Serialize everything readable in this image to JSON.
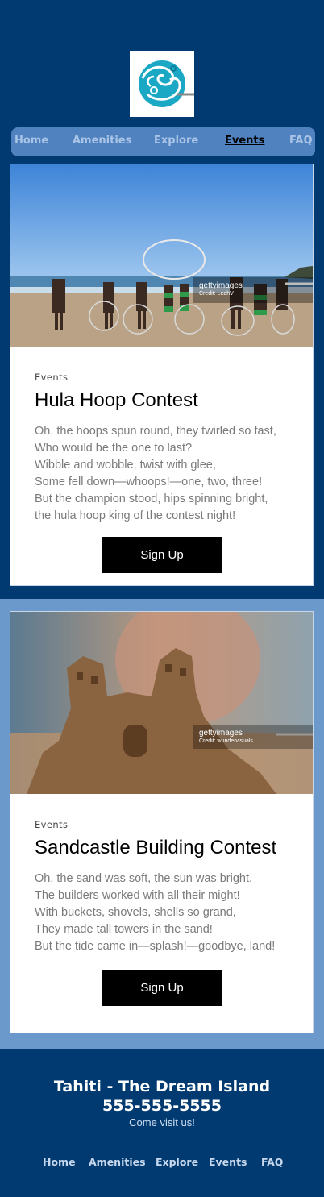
{
  "nav": {
    "items": [
      {
        "label": "Home",
        "active": false
      },
      {
        "label": "Amenities",
        "active": false
      },
      {
        "label": "Explore",
        "active": false
      },
      {
        "label": "Events",
        "active": true
      },
      {
        "label": "FAQ",
        "active": false
      }
    ]
  },
  "cards": [
    {
      "eyebrow": "Events",
      "title": "Hula Hoop Contest",
      "poem": "Oh, the hoops spun round, they twirled so fast,\nWho would be the one to last?\nWibble and wobble, twist with glee,\nSome fell down—whoops!—one, two, three!\nBut the champion stood, hips spinning bright,\nthe hula hoop king of the contest night!",
      "button": "Sign Up",
      "watermark": "gettyimages",
      "credit": "Credit: LeahV"
    },
    {
      "eyebrow": "Events",
      "title": "Sandcastle Building Contest",
      "poem": "Oh, the sand was soft, the sun was bright,\nThe builders worked with all their might!\nWith buckets, shovels, shells so grand,\nThey made tall towers in the sand!\nBut the tide came in—splash!—goodbye, land!",
      "button": "Sign Up",
      "watermark": "gettyimages",
      "credit": "Credit: wundervisuals"
    }
  ],
  "footer": {
    "title": "Tahiti - The Dream Island",
    "phone": "555-555-5555",
    "tagline": "Come visit us!",
    "nav": [
      "Home",
      "Amenities",
      "Explore",
      "Events",
      "FAQ"
    ]
  },
  "colors": {
    "navy": "#003a70",
    "mid_blue": "#6b99cc",
    "nav_bar": "#4f82bf",
    "button": "#000000"
  }
}
